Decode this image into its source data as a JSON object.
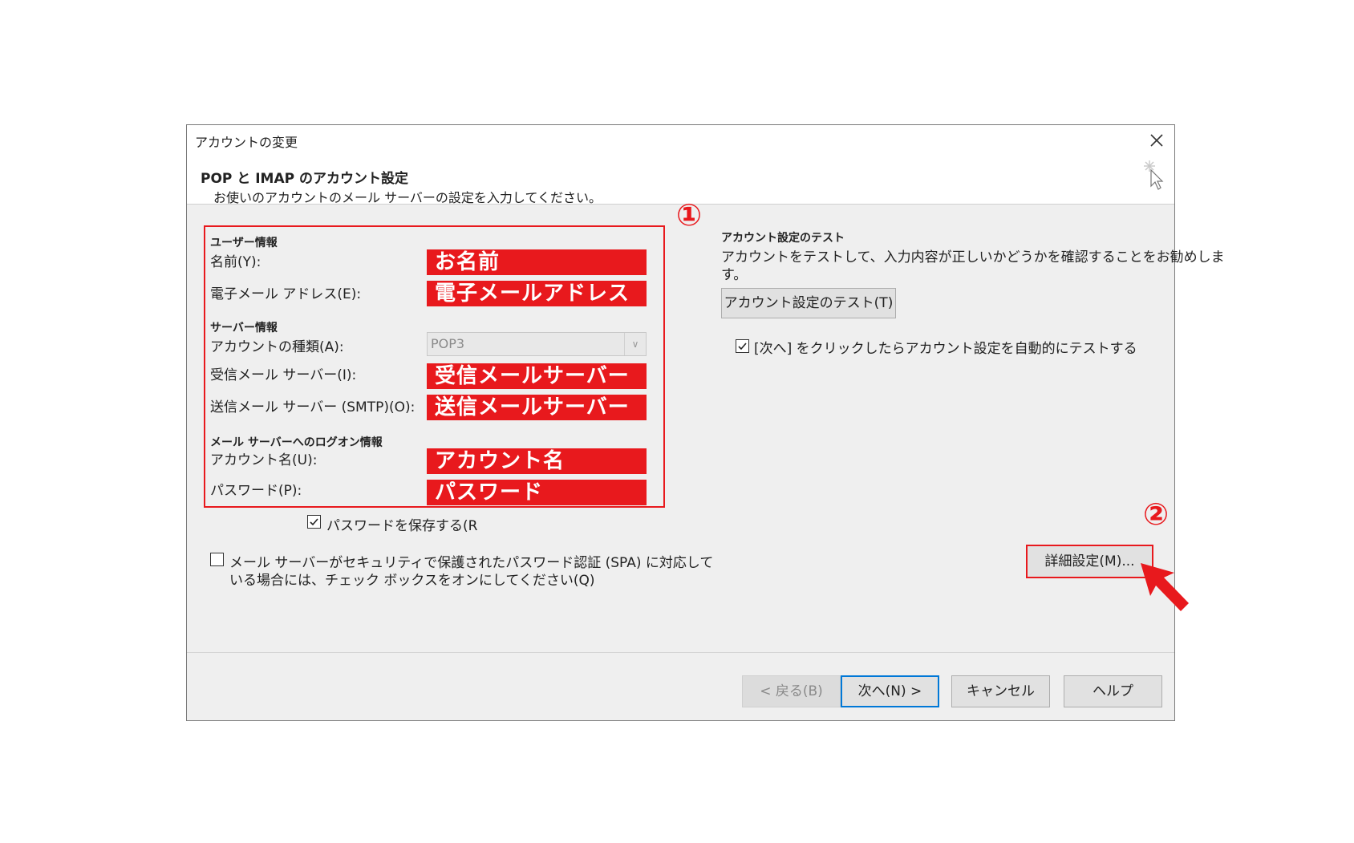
{
  "window": {
    "title": "アカウントの変更",
    "header_title": "POP と IMAP のアカウント設定",
    "header_subtitle": "お使いのアカウントのメール サーバーの設定を入力してください。"
  },
  "left": {
    "user_section": "ユーザー情報",
    "name_label": "名前(Y):",
    "name_value": "お名前",
    "email_label": "電子メール アドレス(E):",
    "email_value": "電子メールアドレス",
    "server_section": "サーバー情報",
    "account_type_label": "アカウントの種類(A):",
    "account_type_value": "POP3",
    "incoming_label": "受信メール サーバー(I):",
    "incoming_value": "受信メールサーバー",
    "outgoing_label": "送信メール サーバー (SMTP)(O):",
    "outgoing_value": "送信メールサーバー",
    "logon_section": "メール サーバーへのログオン情報",
    "account_name_label": "アカウント名(U):",
    "account_name_value": "アカウント名",
    "password_label": "パスワード(P):",
    "password_value": "パスワード",
    "save_password_label": "パスワードを保存する(R",
    "spa_label_line1": "メール サーバーがセキュリティで保護されたパスワード認証 (SPA) に対応して",
    "spa_label_line2": "いる場合には、チェック ボックスをオンにしてください(Q)"
  },
  "right": {
    "test_section": "アカウント設定のテスト",
    "test_desc_line1": "アカウントをテストして、入力内容が正しいかどうかを確認することをお勧めしま",
    "test_desc_line2": "す。",
    "test_button": "アカウント設定のテスト(T)",
    "auto_test_label": "[次へ] をクリックしたらアカウント設定を自動的にテストする",
    "advanced_button": "詳細設定(M)..."
  },
  "annotations": {
    "marker1": "①",
    "marker2": "②",
    "highlight_color": "#e8191d"
  },
  "footer": {
    "back_button": "< 戻る(B)",
    "next_button": "次へ(N) >",
    "cancel_button": "キャンセル",
    "help_button": "ヘルプ"
  }
}
